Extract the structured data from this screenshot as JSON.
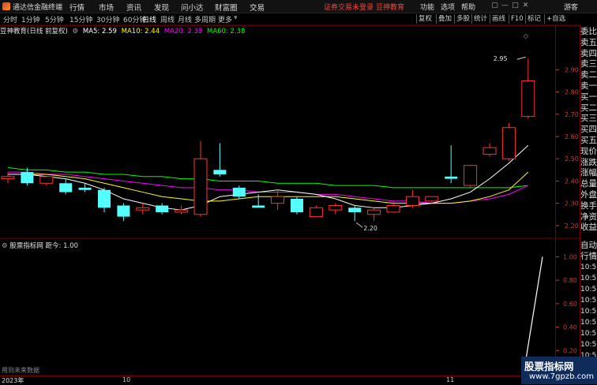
{
  "menubar": {
    "app_title": "通达信金融终端",
    "menus": [
      "行情",
      "市场",
      "资讯",
      "发现",
      "问小达",
      "财富圈",
      "交易"
    ],
    "login_notice": "证券交易未登录",
    "brand": "豆神教育",
    "right_menus": [
      "功能",
      "选项",
      "帮助"
    ],
    "guest": "游客"
  },
  "toolbar": {
    "periods": [
      "分时",
      "1分钟",
      "5分钟",
      "15分钟",
      "30分钟",
      "60分钟",
      "日线",
      "周线",
      "月线",
      "多周期",
      "更多"
    ],
    "active_period": "日线",
    "buttons": [
      "复权",
      "叠加",
      "多股",
      "统计",
      "画线",
      "F10",
      "标记",
      "+自选"
    ]
  },
  "chart_info": {
    "title": "豆神教育(日线 前复权)",
    "ma5_label": "MA5: 2.59",
    "ma10_label": "MA10: 2.44",
    "ma20_label": "MA20: 2.38",
    "ma60_label": "MA60: 2.38",
    "colors": {
      "ma5": "#ffffff",
      "ma10": "#ffff00",
      "ma20": "#ff00ff",
      "ma60": "#00ff00",
      "up": "#ff3232",
      "down": "#54ffff",
      "axis": "#ff3333"
    }
  },
  "right_panel": [
    "委比",
    "卖五",
    "卖四",
    "卖三",
    "卖二",
    "卖一",
    "买一",
    "买二",
    "买三",
    "买四",
    "买五",
    "现价",
    "涨跌",
    "涨幅",
    "总量",
    "外盘",
    "换手",
    "净资",
    "收益"
  ],
  "sub_right_panel": [
    "自动",
    "行情",
    "10:57",
    "10:57",
    "10:57",
    "10:57",
    "10:57",
    "10:57",
    "10:57",
    "10:57",
    "10:57",
    "10:57"
  ],
  "sub_indicator": {
    "title": "股票指标网",
    "label": "距今: 1.00"
  },
  "status_text": "用到未来数据",
  "watermark": {
    "line1": "股票指标网",
    "line2": "www.7gpzb.com"
  },
  "dates": [
    "2023年",
    "10",
    "11"
  ],
  "chart_data": {
    "type": "candlestick",
    "ylim": [
      2.15,
      3.05
    ],
    "yticks": [
      2.2,
      2.3,
      2.4,
      2.5,
      2.6,
      2.7,
      2.8,
      2.9
    ],
    "sub_ylim": [
      0,
      1.05
    ],
    "sub_yticks": [
      0.2,
      0.4,
      0.6,
      0.8,
      1.0
    ],
    "high_annotation": "2.95",
    "low_annotation": "2.20",
    "candles": [
      {
        "o": 2.41,
        "c": 2.42,
        "h": 2.44,
        "l": 2.39
      },
      {
        "o": 2.44,
        "c": 2.39,
        "h": 2.46,
        "l": 2.38
      },
      {
        "o": 2.39,
        "c": 2.42,
        "h": 2.42,
        "l": 2.38
      },
      {
        "o": 2.39,
        "c": 2.35,
        "h": 2.41,
        "l": 2.34
      },
      {
        "o": 2.37,
        "c": 2.36,
        "h": 2.39,
        "l": 2.35
      },
      {
        "o": 2.36,
        "c": 2.28,
        "h": 2.37,
        "l": 2.26
      },
      {
        "o": 2.29,
        "c": 2.24,
        "h": 2.3,
        "l": 2.22
      },
      {
        "o": 2.27,
        "c": 2.28,
        "h": 2.3,
        "l": 2.25
      },
      {
        "o": 2.29,
        "c": 2.26,
        "h": 2.3,
        "l": 2.25
      },
      {
        "o": 2.26,
        "c": 2.27,
        "h": 2.29,
        "l": 2.25
      },
      {
        "o": 2.25,
        "c": 2.5,
        "h": 2.58,
        "l": 2.24
      },
      {
        "o": 2.45,
        "c": 2.43,
        "h": 2.57,
        "l": 2.42
      },
      {
        "o": 2.37,
        "c": 2.33,
        "h": 2.38,
        "l": 2.32
      },
      {
        "o": 2.29,
        "c": 2.28,
        "h": 2.34,
        "l": 2.28
      },
      {
        "o": 2.3,
        "c": 2.33,
        "h": 2.36,
        "l": 2.27
      },
      {
        "o": 2.32,
        "c": 2.26,
        "h": 2.33,
        "l": 2.25
      },
      {
        "o": 2.24,
        "c": 2.28,
        "h": 2.29,
        "l": 2.24
      },
      {
        "o": 2.27,
        "c": 2.29,
        "h": 2.3,
        "l": 2.25
      },
      {
        "o": 2.28,
        "c": 2.26,
        "h": 2.29,
        "l": 2.22
      },
      {
        "o": 2.25,
        "c": 2.27,
        "h": 2.28,
        "l": 2.22
      },
      {
        "o": 2.26,
        "c": 2.29,
        "h": 2.31,
        "l": 2.26
      },
      {
        "o": 2.29,
        "c": 2.33,
        "h": 2.36,
        "l": 2.28
      },
      {
        "o": 2.31,
        "c": 2.33,
        "h": 2.33,
        "l": 2.3
      },
      {
        "o": 2.42,
        "c": 2.41,
        "h": 2.56,
        "l": 2.39
      },
      {
        "o": 2.38,
        "c": 2.47,
        "h": 2.47,
        "l": 2.37
      },
      {
        "o": 2.52,
        "c": 2.55,
        "h": 2.57,
        "l": 2.51
      },
      {
        "o": 2.5,
        "c": 2.64,
        "h": 2.66,
        "l": 2.49
      },
      {
        "o": 2.69,
        "c": 2.85,
        "h": 2.95,
        "l": 2.68
      }
    ],
    "x_indices": [
      0,
      1,
      2,
      3,
      4,
      5,
      6,
      7,
      8,
      9,
      10,
      11,
      12,
      13,
      14,
      15,
      16,
      17,
      18,
      19,
      20,
      21,
      22,
      23,
      24,
      25,
      26,
      27
    ],
    "ma5": [
      2.43,
      2.43,
      2.42,
      2.41,
      2.39,
      2.36,
      2.32,
      2.3,
      2.28,
      2.27,
      2.29,
      2.33,
      2.34,
      2.35,
      2.36,
      2.35,
      2.34,
      2.32,
      2.29,
      2.28,
      2.28,
      2.29,
      2.3,
      2.32,
      2.35,
      2.41,
      2.48,
      2.56
    ],
    "ma10": [
      2.43,
      2.43,
      2.43,
      2.42,
      2.41,
      2.39,
      2.37,
      2.35,
      2.33,
      2.32,
      2.31,
      2.31,
      2.32,
      2.33,
      2.33,
      2.33,
      2.33,
      2.33,
      2.32,
      2.31,
      2.3,
      2.3,
      2.3,
      2.3,
      2.31,
      2.33,
      2.36,
      2.44
    ],
    "ma20": [
      2.44,
      2.44,
      2.43,
      2.43,
      2.42,
      2.41,
      2.4,
      2.39,
      2.38,
      2.37,
      2.37,
      2.36,
      2.36,
      2.35,
      2.35,
      2.35,
      2.34,
      2.34,
      2.33,
      2.32,
      2.31,
      2.31,
      2.3,
      2.3,
      2.31,
      2.32,
      2.34,
      2.38
    ],
    "ma60": [
      2.46,
      2.45,
      2.45,
      2.44,
      2.44,
      2.43,
      2.43,
      2.42,
      2.42,
      2.41,
      2.41,
      2.4,
      2.4,
      2.4,
      2.39,
      2.39,
      2.39,
      2.38,
      2.38,
      2.38,
      2.37,
      2.37,
      2.37,
      2.37,
      2.37,
      2.37,
      2.37,
      2.38
    ],
    "sub_series": [
      {
        "x": 27,
        "v": 0.0
      },
      {
        "x": 27.2,
        "v": 1.0
      }
    ]
  }
}
